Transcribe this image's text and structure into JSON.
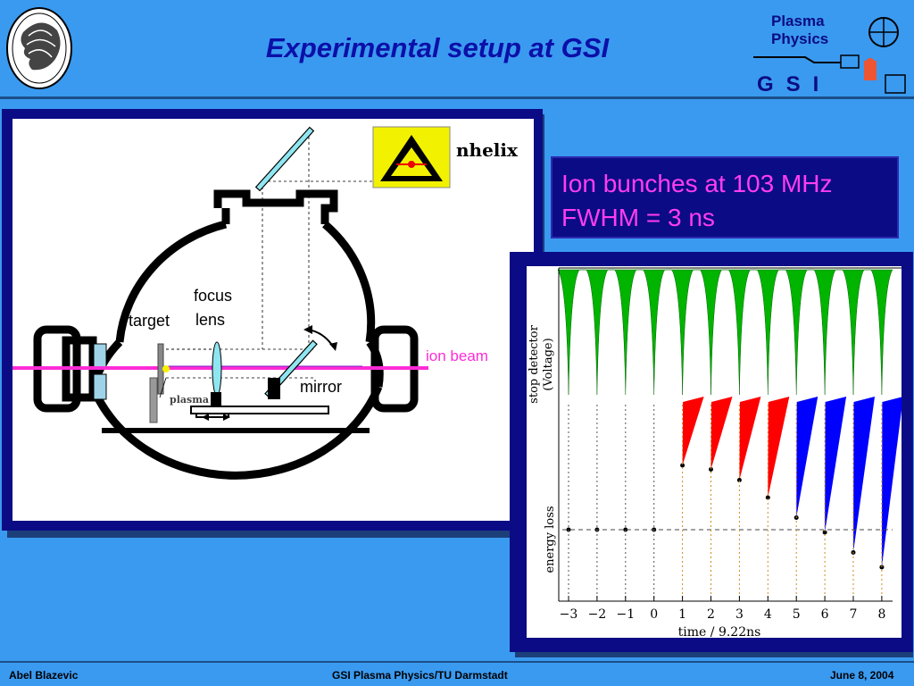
{
  "title": "Experimental setup at GSI",
  "logo": {
    "line1": "Plasma",
    "line2": "Physics",
    "gsi": "GSI"
  },
  "diagram": {
    "laser_name": "nhelix",
    "labels": {
      "focus": "focus",
      "lens": "lens",
      "target": "target",
      "mirror": "mirror",
      "plasma": "plasma",
      "ion_beam": "ion beam"
    }
  },
  "info": {
    "line1": "Ion bunches at 103 MHz",
    "line2": "FWHM = 3 ns"
  },
  "plot": {
    "ylabel_top": "stop detector\n(Voltage)",
    "ylabel_bottom": "energy loss",
    "xlabel": "time / 9.22ns",
    "ticks": [
      "−3",
      "−2",
      "−1",
      "0",
      "1",
      "2",
      "3",
      "4",
      "5",
      "6",
      "7",
      "8"
    ]
  },
  "chart_data": {
    "type": "scatter",
    "title": "",
    "xlabel": "time / 9.22ns",
    "ylabel": "energy loss",
    "x": [
      -3,
      -2,
      -1,
      0,
      1,
      2,
      3,
      4,
      5,
      6,
      7,
      8
    ],
    "series": [
      {
        "name": "",
        "color": "#000000",
        "values": [
          0,
          0,
          0,
          0,
          0.48,
          0.45,
          0.37,
          0.24,
          0.09,
          -0.02,
          -0.17,
          -0.28
        ]
      }
    ],
    "colors": {
      "reference": "#00b400",
      "early": "#ff0000",
      "late": "#0000ff"
    }
  },
  "footer": {
    "author": "Abel Blazevic",
    "institute": "GSI Plasma Physics/TU Darmstadt",
    "date": "June 8,  2004"
  }
}
